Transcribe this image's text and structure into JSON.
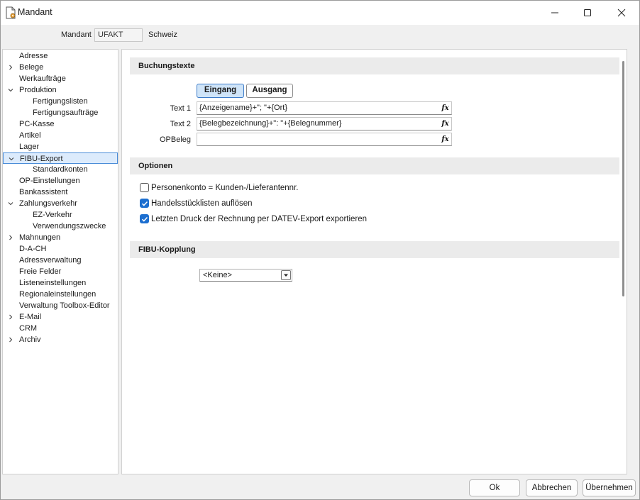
{
  "window": {
    "title": "Mandant",
    "icon": "document-gear-icon"
  },
  "header": {
    "mandant_label": "Mandant",
    "mandant_code": "UFAKT",
    "mandant_name": "Schweiz"
  },
  "tree": {
    "items": [
      {
        "label": "Adresse"
      },
      {
        "label": "Belege",
        "expander": "collapsed"
      },
      {
        "label": "Werkaufträge"
      },
      {
        "label": "Produktion",
        "expander": "expanded"
      },
      {
        "label": "Fertigungslisten"
      },
      {
        "label": "Fertigungsaufträge"
      },
      {
        "label": "PC-Kasse"
      },
      {
        "label": "Artikel"
      },
      {
        "label": "Lager"
      },
      {
        "label": "FIBU-Export",
        "expander": "expanded",
        "selected": true
      },
      {
        "label": "Standardkonten"
      },
      {
        "label": "OP-Einstellungen"
      },
      {
        "label": "Bankassistent"
      },
      {
        "label": "Zahlungsverkehr",
        "expander": "expanded"
      },
      {
        "label": "EZ-Verkehr"
      },
      {
        "label": "Verwendungszwecke"
      },
      {
        "label": "Mahnungen",
        "expander": "collapsed"
      },
      {
        "label": "D-A-CH"
      },
      {
        "label": "Adressverwaltung"
      },
      {
        "label": "Freie Felder"
      },
      {
        "label": "Listeneinstellungen"
      },
      {
        "label": "Regionaleinstellungen"
      },
      {
        "label": "Verwaltung Toolbox-Editor"
      },
      {
        "label": "E-Mail",
        "expander": "collapsed"
      },
      {
        "label": "CRM"
      },
      {
        "label": "Archiv",
        "expander": "collapsed"
      }
    ]
  },
  "buchungstexte": {
    "header": "Buchungstexte",
    "tab_eingang": "Eingang",
    "tab_ausgang": "Ausgang",
    "active_tab": "Eingang",
    "text1_label": "Text 1",
    "text1_value": "{Anzeigename}+\"; \"+{Ort}",
    "text2_label": "Text 2",
    "text2_value": "{Belegbezeichnung}+\": \"+{Belegnummer}",
    "opbeleg_label": "OPBeleg",
    "opbeleg_value": "",
    "fx_glyph": "fx"
  },
  "optionen": {
    "header": "Optionen",
    "options": [
      {
        "label": "Personenkonto = Kunden-/Lieferantennr.",
        "checked": false
      },
      {
        "label": "Handelsstücklisten auflösen",
        "checked": true
      },
      {
        "label": "Letzten Druck der Rechnung per DATEV-Export exportieren",
        "checked": true
      }
    ]
  },
  "fibu_kopplung": {
    "header": "FIBU-Kopplung",
    "selected": "<Keine>"
  },
  "footer": {
    "ok": "Ok",
    "cancel": "Abbrechen",
    "apply": "Übernehmen"
  },
  "colors": {
    "accent": "#1d6fd0",
    "selected_bg": "#dcebfc",
    "section_bg": "#ebebeb"
  }
}
